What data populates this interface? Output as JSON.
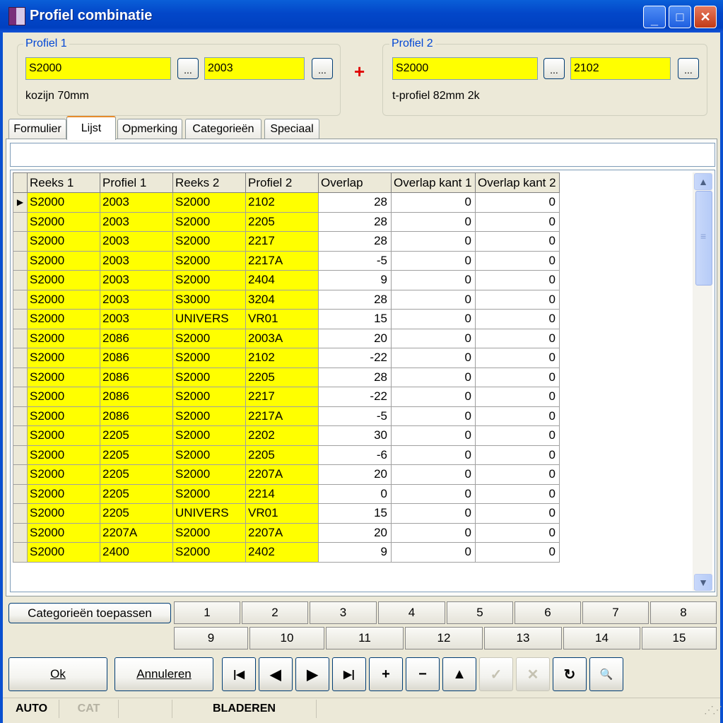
{
  "window": {
    "title": "Profiel combinatie",
    "min": "_",
    "max": "□",
    "close": "✕"
  },
  "profiel1": {
    "label": "Profiel 1",
    "reeks": "S2000",
    "profiel": "2003",
    "desc": "kozijn 70mm",
    "browse": "..."
  },
  "profiel2": {
    "label": "Profiel 2",
    "reeks": "S2000",
    "profiel": "2102",
    "desc": "t-profiel 82mm 2k",
    "browse": "..."
  },
  "plus_sign": "+",
  "tabs": [
    "Formulier",
    "Lijst",
    "Opmerking",
    "Categorieën",
    "Speciaal"
  ],
  "filter_value": "",
  "grid": {
    "headers": [
      "Reeks 1",
      "Profiel 1",
      "Reeks 2",
      "Profiel 2",
      "Overlap",
      "Overlap kant 1",
      "Overlap kant 2"
    ],
    "current_marker": "▶",
    "rows": [
      [
        "S2000",
        "2003",
        "S2000",
        "2102",
        "28",
        "0",
        "0"
      ],
      [
        "S2000",
        "2003",
        "S2000",
        "2205",
        "28",
        "0",
        "0"
      ],
      [
        "S2000",
        "2003",
        "S2000",
        "2217",
        "28",
        "0",
        "0"
      ],
      [
        "S2000",
        "2003",
        "S2000",
        "2217A",
        "-5",
        "0",
        "0"
      ],
      [
        "S2000",
        "2003",
        "S2000",
        "2404",
        "9",
        "0",
        "0"
      ],
      [
        "S2000",
        "2003",
        "S3000",
        "3204",
        "28",
        "0",
        "0"
      ],
      [
        "S2000",
        "2003",
        "UNIVERS",
        "VR01",
        "15",
        "0",
        "0"
      ],
      [
        "S2000",
        "2086",
        "S2000",
        "2003A",
        "20",
        "0",
        "0"
      ],
      [
        "S2000",
        "2086",
        "S2000",
        "2102",
        "-22",
        "0",
        "0"
      ],
      [
        "S2000",
        "2086",
        "S2000",
        "2205",
        "28",
        "0",
        "0"
      ],
      [
        "S2000",
        "2086",
        "S2000",
        "2217",
        "-22",
        "0",
        "0"
      ],
      [
        "S2000",
        "2086",
        "S2000",
        "2217A",
        "-5",
        "0",
        "0"
      ],
      [
        "S2000",
        "2205",
        "S2000",
        "2202",
        "30",
        "0",
        "0"
      ],
      [
        "S2000",
        "2205",
        "S2000",
        "2205",
        "-6",
        "0",
        "0"
      ],
      [
        "S2000",
        "2205",
        "S2000",
        "2207A",
        "20",
        "0",
        "0"
      ],
      [
        "S2000",
        "2205",
        "S2000",
        "2214",
        "0",
        "0",
        "0"
      ],
      [
        "S2000",
        "2205",
        "UNIVERS",
        "VR01",
        "15",
        "0",
        "0"
      ],
      [
        "S2000",
        "2207A",
        "S2000",
        "2207A",
        "20",
        "0",
        "0"
      ],
      [
        "S2000",
        "2400",
        "S2000",
        "2402",
        "9",
        "0",
        "0"
      ]
    ]
  },
  "scrollbar": {
    "up": "▲",
    "down": "▼",
    "grip": "≡"
  },
  "categories": {
    "apply_label": "Categorieën toepassen",
    "row1": [
      "1",
      "2",
      "3",
      "4",
      "5",
      "6",
      "7",
      "8"
    ],
    "row2": [
      "9",
      "10",
      "11",
      "12",
      "13",
      "14",
      "15"
    ]
  },
  "buttons": {
    "ok": "Ok",
    "cancel": "Annuleren"
  },
  "nav": [
    {
      "name": "first-record-button",
      "icon": "first-icon",
      "glyph": "|◀",
      "enabled": true
    },
    {
      "name": "prev-record-button",
      "icon": "prev-icon",
      "glyph": "◀",
      "enabled": true
    },
    {
      "name": "next-record-button",
      "icon": "next-icon",
      "glyph": "▶",
      "enabled": true
    },
    {
      "name": "last-record-button",
      "icon": "last-icon",
      "glyph": "▶|",
      "enabled": true
    },
    {
      "name": "insert-record-button",
      "icon": "plus-icon",
      "glyph": "+",
      "enabled": true
    },
    {
      "name": "delete-record-button",
      "icon": "minus-icon",
      "glyph": "−",
      "enabled": true
    },
    {
      "name": "edit-record-button",
      "icon": "up-icon",
      "glyph": "▲",
      "enabled": true
    },
    {
      "name": "post-record-button",
      "icon": "check-icon",
      "glyph": "✓",
      "enabled": false
    },
    {
      "name": "cancel-edit-button",
      "icon": "x-icon",
      "glyph": "✕",
      "enabled": false
    },
    {
      "name": "refresh-button",
      "icon": "refresh-icon",
      "glyph": "↻",
      "enabled": true
    },
    {
      "name": "find-button",
      "icon": "binoculars-icon",
      "glyph": "🔍",
      "enabled": true
    }
  ],
  "status": {
    "mode1": "AUTO",
    "mode2": "CAT",
    "state": "BLADEREN"
  },
  "colors": {
    "field_yellow": "#ffff00",
    "title_blue": "#0040c0",
    "group_label": "#0046d5",
    "plus_red": "#e00000"
  }
}
